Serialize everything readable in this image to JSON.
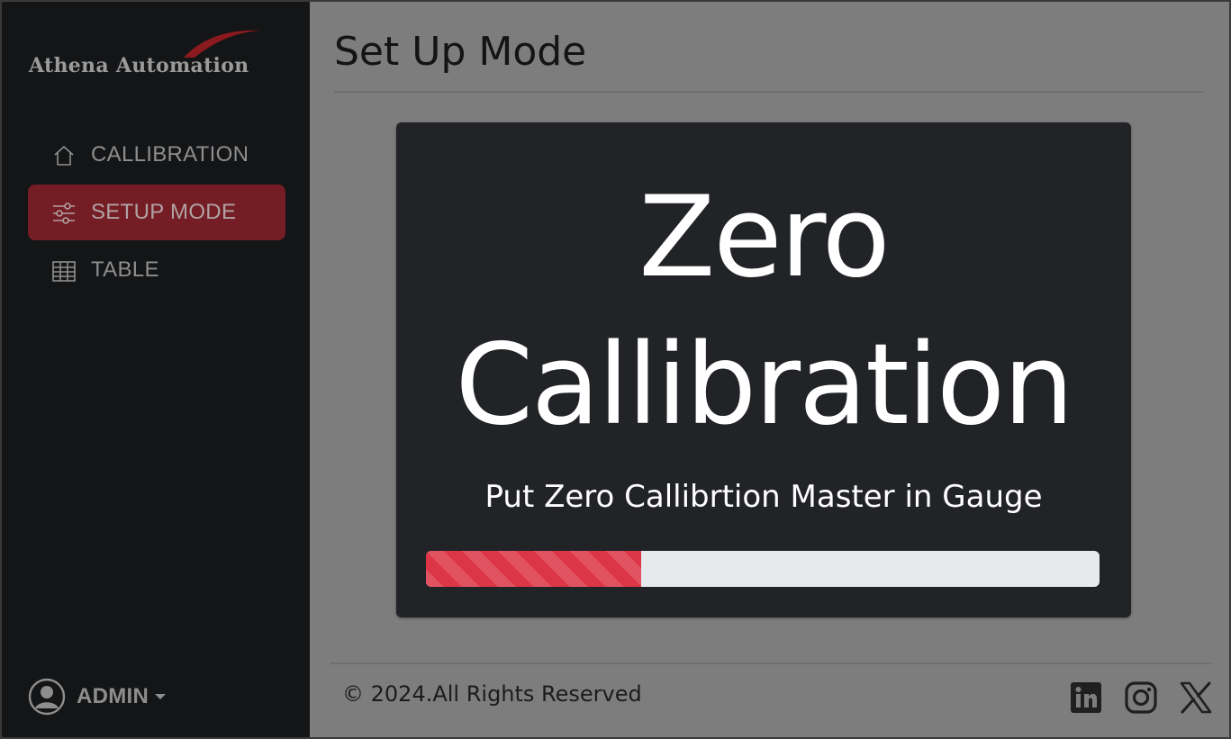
{
  "sidebar": {
    "logo_text": "Athena Automation",
    "items": [
      {
        "label": "CALLIBRATION",
        "icon": "home-icon",
        "active": false
      },
      {
        "label": "SETUP MODE",
        "icon": "sliders-icon",
        "active": true
      },
      {
        "label": "TABLE",
        "icon": "table-icon",
        "active": false
      }
    ],
    "user": {
      "name": "ADMIN",
      "icon": "user-circle-icon"
    }
  },
  "main": {
    "title": "Set Up Mode",
    "card": {
      "heading": "Zero Callibration",
      "instruction": "Put Zero Callibrtion Master in Gauge",
      "progress_percent": 32
    }
  },
  "footer": {
    "copyright": "© 2024.All Rights Reserved",
    "social": [
      "linkedin-icon",
      "instagram-icon",
      "x-icon"
    ]
  },
  "colors": {
    "sidebar_bg": "#141517",
    "active_item_bg": "#741d24",
    "card_bg": "#212327",
    "progress_fill": "#dc3545",
    "progress_track": "#e7eaed",
    "logo_swoosh": "#8b1a1f"
  }
}
